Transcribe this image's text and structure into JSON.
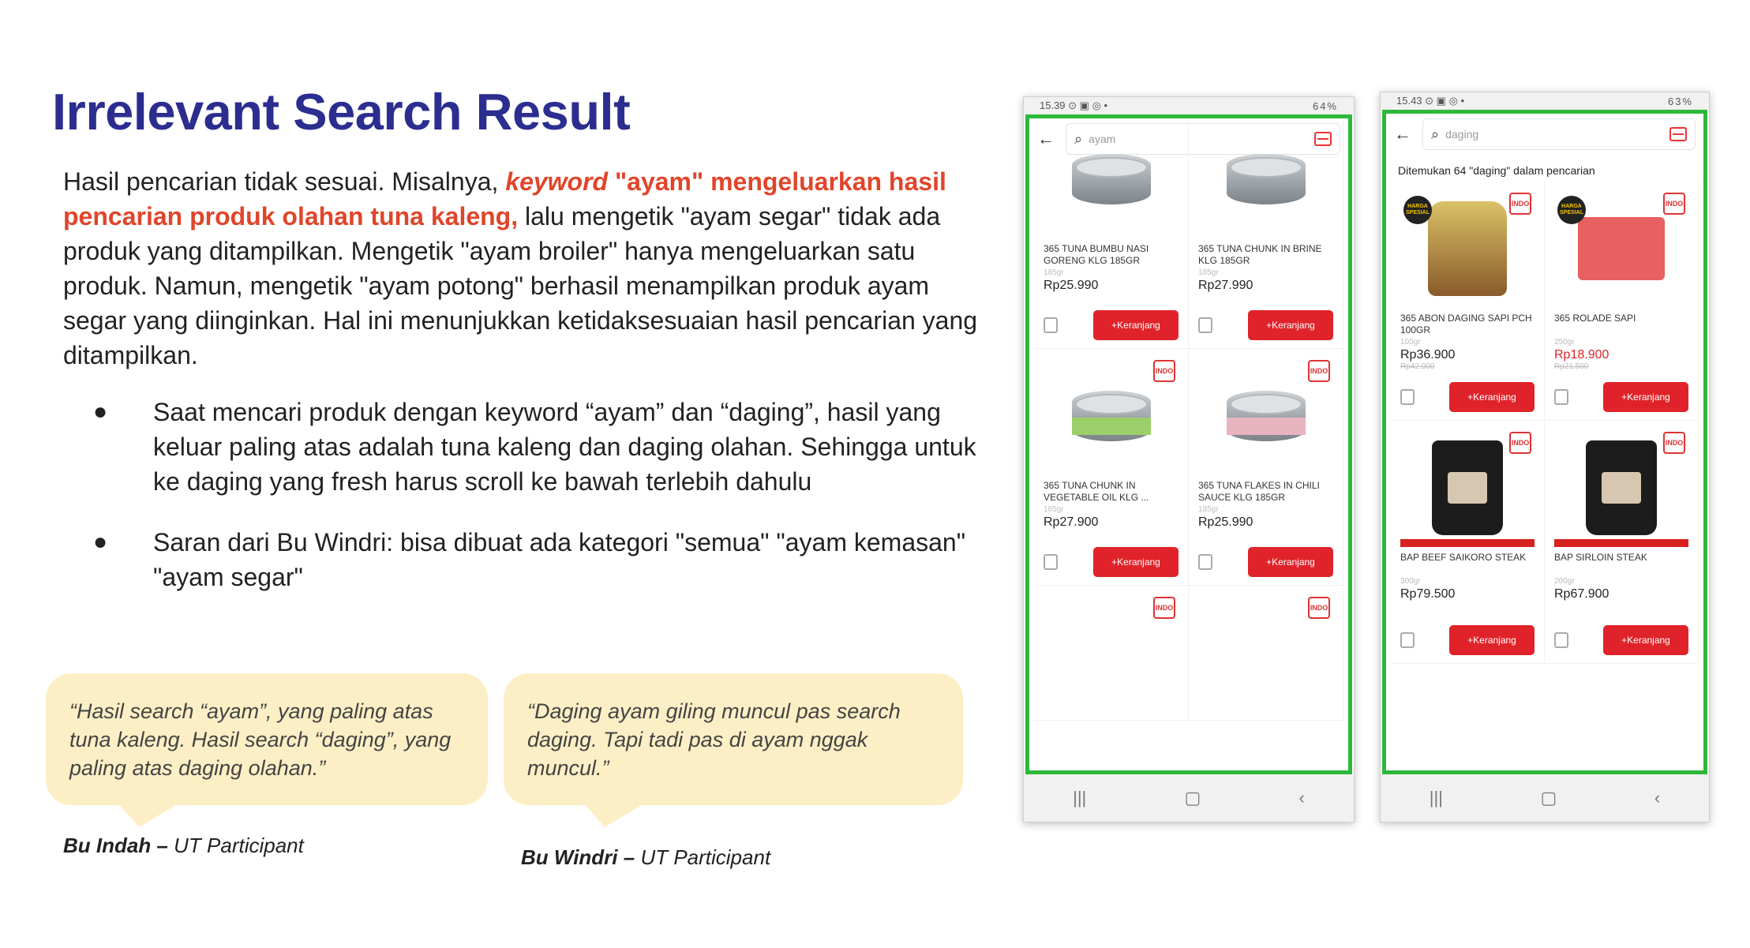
{
  "slide": {
    "title": "Irrelevant Search Result",
    "intro_before": "Hasil pencarian tidak sesuai. Misalnya, ",
    "intro_hl_italic": "keyword",
    "intro_hl": " \"ayam\" mengeluarkan hasil pencarian produk olahan tuna kaleng,",
    "intro_after": " lalu mengetik \"ayam segar\" tidak ada produk yang ditampilkan. Mengetik \"ayam broiler\" hanya mengeluarkan satu produk. Namun, mengetik \"ayam potong\" berhasil menampilkan produk ayam segar yang diinginkan. Hal ini menunjukkan ketidaksesuaian hasil pencarian yang ditampilkan.",
    "bullet_symbol": "●",
    "bullets": [
      "Saat mencari produk dengan keyword “ayam” dan “daging”, hasil yang keluar paling atas adalah tuna kaleng dan daging olahan. Sehingga untuk ke daging yang fresh harus scroll ke bawah terlebih dahulu",
      "Saran dari Bu Windri: bisa dibuat ada kategori \"semua\" \"ayam kemasan\" \"ayam segar\""
    ],
    "quotes": [
      {
        "text": "“Hasil search “ayam”, yang paling atas tuna kaleng. Hasil search “daging”, yang paling atas daging olahan.”",
        "name": "Bu Indah –",
        "role": " UT Participant"
      },
      {
        "text": "“Daging ayam giling muncul pas search daging. Tapi tadi pas di ayam nggak muncul.”",
        "name": "Bu Windri –",
        "role": " UT Participant"
      }
    ]
  },
  "phone1": {
    "status_time": "15.39",
    "status_icons": "⊙ ▣ ◎ •",
    "status_right": "64%",
    "search_value": "ayam",
    "products": [
      {
        "name": "365 TUNA BUMBU NASI GORENG KLG 185GR",
        "weight": "185gr",
        "price": "Rp25.990",
        "img": "can-top"
      },
      {
        "name": "365 TUNA CHUNK IN BRINE KLG 185GR",
        "weight": "185gr",
        "price": "Rp27.990",
        "img": "can-top"
      },
      {
        "name": "365 TUNA CHUNK IN VEGETABLE OIL KLG ...",
        "weight": "185gr",
        "price": "Rp27.900",
        "img": "can-green"
      },
      {
        "name": "365 TUNA FLAKES IN CHILI SAUCE KLG 185GR",
        "weight": "185gr",
        "price": "Rp25.990",
        "img": "can-pink"
      }
    ],
    "cart_label": "+Keranjang",
    "badge_text": "INDO"
  },
  "phone2": {
    "status_time": "15.43",
    "status_icons": "⊙ ▣ ◎ •",
    "status_right": "63%",
    "search_value": "daging",
    "found_text": "Ditemukan 64 \"daging\" dalam pencarian",
    "harga_text": "HARGA SPESIAL",
    "products": [
      {
        "name": "365 ABON DAGING SAPI PCH 100GR",
        "weight": "100gr",
        "price": "Rp36.900",
        "old": "Rp42.900",
        "img": "jar"
      },
      {
        "name": "365 ROLADE SAPI",
        "weight": "250gr",
        "price": "Rp18.900",
        "old": "Rp21.500",
        "img": "box"
      },
      {
        "name": "BAP BEEF SAIKORO STEAK",
        "weight": "300gr",
        "price": "Rp79.500",
        "old": "",
        "img": "pouch"
      },
      {
        "name": "BAP SIRLOIN STEAK",
        "weight": "200gr",
        "price": "Rp67.900",
        "old": "",
        "img": "pouch"
      }
    ],
    "cart_label": "+Keranjang",
    "badge_text": "INDO"
  },
  "navbar": {
    "recents": "|||",
    "home": "▢",
    "back": "‹"
  },
  "colors": {
    "title": "#2b2e8f",
    "highlight": "#e0452a",
    "frame": "#2db83a",
    "cart": "#e0232a",
    "bubble": "#fdefc5"
  }
}
